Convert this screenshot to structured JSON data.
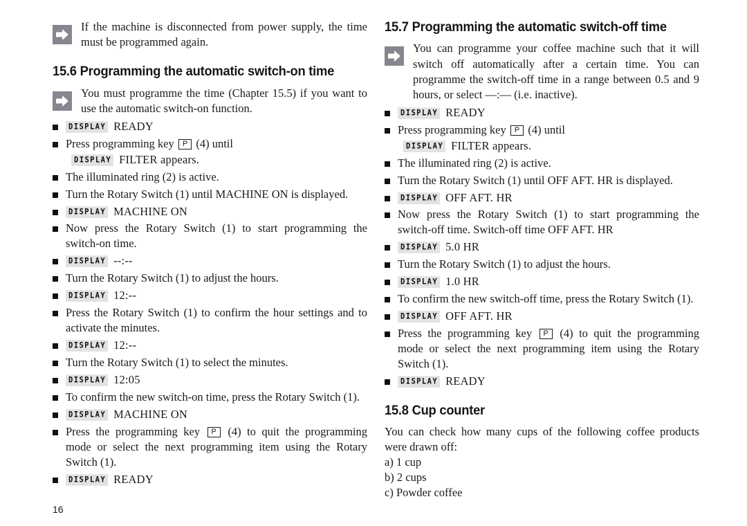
{
  "page": {
    "number": "16",
    "display_badge_label": "DISPLAY",
    "p_key_label": "P"
  },
  "left_column": {
    "intro_note": "If the machine is disconnected from power supply, the time must be programmed again.",
    "section": {
      "heading": "15.6 Programming the automatic switch-on time",
      "note": "You must programme the time (Chapter 15.5) if you want to use the automatic switch-on function."
    },
    "steps": [
      {
        "type": "display",
        "value": "READY"
      },
      {
        "type": "key_then_display",
        "text_before": "Press programming key",
        "text_after": "(4) until",
        "display_value": "FILTER appears."
      },
      {
        "type": "text",
        "text": "The illuminated ring (2) is active."
      },
      {
        "type": "text",
        "text": "Turn the Rotary Switch (1) until MACHINE ON is displayed."
      },
      {
        "type": "display",
        "value": "MACHINE ON"
      },
      {
        "type": "text",
        "text": "Now press the Rotary Switch (1) to start programming the switch-on time."
      },
      {
        "type": "display",
        "value": "--:--"
      },
      {
        "type": "text",
        "text": "Turn the Rotary Switch (1) to adjust the hours."
      },
      {
        "type": "display",
        "value": "12:--"
      },
      {
        "type": "text",
        "text": "Press the Rotary Switch (1) to confirm the hour settings and to activate the minutes."
      },
      {
        "type": "display",
        "value": "12:--"
      },
      {
        "type": "text",
        "text": "Turn the Rotary Switch (1) to select the minutes."
      },
      {
        "type": "display",
        "value": "12:05"
      },
      {
        "type": "text",
        "text": "To confirm the new switch-on time, press the Rotary Switch (1)."
      },
      {
        "type": "display",
        "value": "MACHINE ON"
      },
      {
        "type": "key_inline",
        "text_before": "Press the programming key",
        "text_after": "(4) to quit the programming mode or select the next programming item using the Rotary Switch (1)."
      },
      {
        "type": "display",
        "value": "READY"
      }
    ]
  },
  "right_column": {
    "section_switch_off": {
      "heading": "15.7 Programming the automatic switch-off time",
      "note": "You can programme your coffee machine such that it will switch off automatically after a certain time. You can programme the switch-off time in a range between 0.5 and 9 hours, or select —:— (i.e. inactive)."
    },
    "steps": [
      {
        "type": "display",
        "value": "READY"
      },
      {
        "type": "key_then_display",
        "text_before": "Press programming key",
        "text_after": "(4) until",
        "display_value": "FILTER appears."
      },
      {
        "type": "text",
        "text": "The illuminated ring (2) is active."
      },
      {
        "type": "text",
        "text": "Turn the Rotary Switch (1) until OFF AFT. HR is displayed."
      },
      {
        "type": "display",
        "value": "OFF AFT. HR"
      },
      {
        "type": "text",
        "text": "Now press the Rotary Switch (1) to start programming the switch-off time. Switch-off time OFF AFT. HR"
      },
      {
        "type": "display",
        "value": "5.0 HR"
      },
      {
        "type": "text",
        "text": "Turn the Rotary Switch (1) to adjust the hours."
      },
      {
        "type": "display",
        "value": "1.0 HR"
      },
      {
        "type": "text",
        "text": "To confirm the new switch-off time, press the Rotary Switch (1)."
      },
      {
        "type": "display",
        "value": "OFF AFT. HR"
      },
      {
        "type": "key_inline",
        "text_before": "Press the programming key",
        "text_after": "(4) to quit the programming mode or select the next programming item using the Rotary Switch (1)."
      },
      {
        "type": "display",
        "value": "READY"
      }
    ],
    "section_cup_counter": {
      "heading": "15.8 Cup counter",
      "intro": "You can check how many cups of the following coffee products were drawn off:",
      "items": [
        "a) 1 cup",
        "b) 2 cups",
        "c) Powder coffee"
      ]
    }
  }
}
